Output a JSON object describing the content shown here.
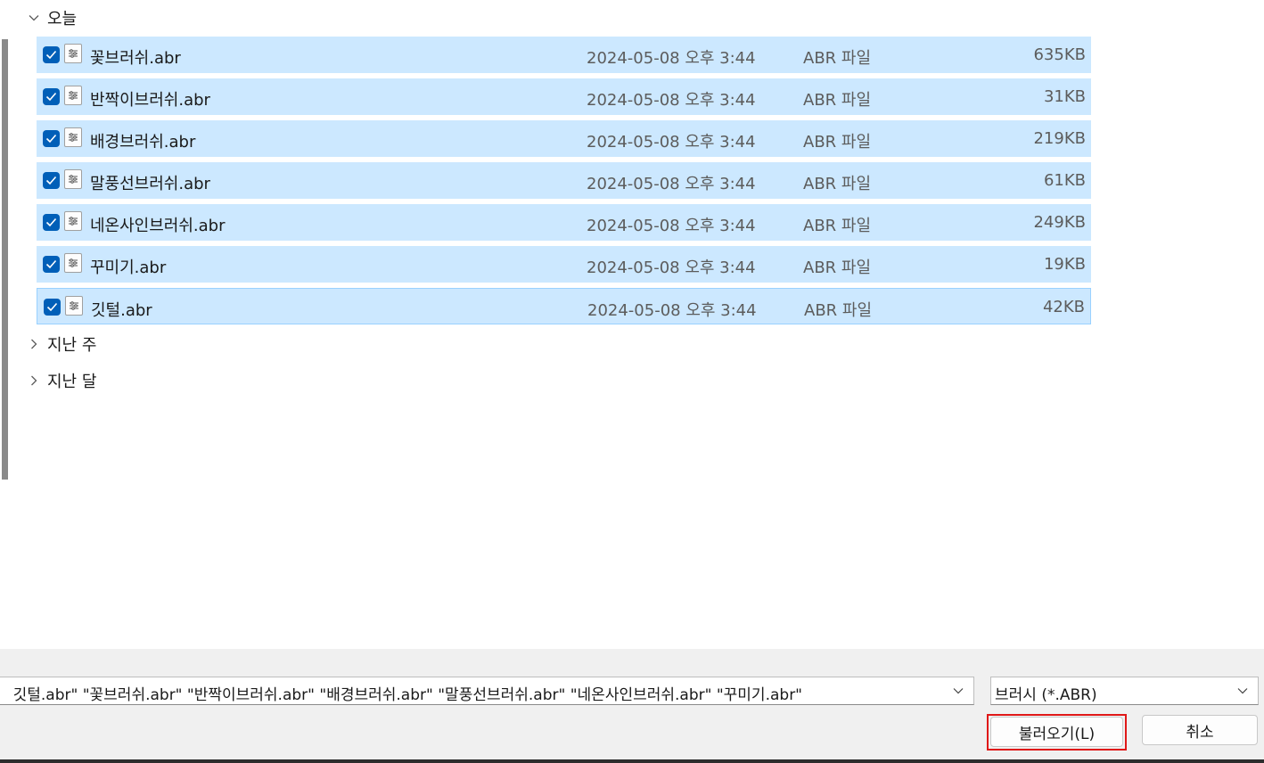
{
  "groups": {
    "today": {
      "label": "오늘",
      "expanded": true
    },
    "last_week": {
      "label": "지난 주",
      "expanded": false
    },
    "last_month": {
      "label": "지난 달",
      "expanded": false
    }
  },
  "files": [
    {
      "name": "꽃브러쉬.abr",
      "date": "2024-05-08 오후 3:44",
      "type": "ABR 파일",
      "size": "635KB",
      "checked": true
    },
    {
      "name": "반짝이브러쉬.abr",
      "date": "2024-05-08 오후 3:44",
      "type": "ABR 파일",
      "size": "31KB",
      "checked": true
    },
    {
      "name": "배경브러쉬.abr",
      "date": "2024-05-08 오후 3:44",
      "type": "ABR 파일",
      "size": "219KB",
      "checked": true
    },
    {
      "name": "말풍선브러쉬.abr",
      "date": "2024-05-08 오후 3:44",
      "type": "ABR 파일",
      "size": "61KB",
      "checked": true
    },
    {
      "name": "네온사인브러쉬.abr",
      "date": "2024-05-08 오후 3:44",
      "type": "ABR 파일",
      "size": "249KB",
      "checked": true
    },
    {
      "name": "꾸미기.abr",
      "date": "2024-05-08 오후 3:44",
      "type": "ABR 파일",
      "size": "19KB",
      "checked": true
    },
    {
      "name": "깃털.abr",
      "date": "2024-05-08 오후 3:44",
      "type": "ABR 파일",
      "size": "42KB",
      "checked": true
    }
  ],
  "footer": {
    "filename_value": "깃털.abr\" \"꽃브러쉬.abr\" \"반짝이브러쉬.abr\" \"배경브러쉬.abr\" \"말풍선브러쉬.abr\" \"네온사인브러쉬.abr\" \"꾸미기.abr\"",
    "filter_value": "브러시 (*.ABR)",
    "open_label": "불러오기(L)",
    "cancel_label": "취소"
  },
  "colors": {
    "selection": "#cce8ff",
    "checkbox": "#005fb8",
    "highlight": "#e01818"
  }
}
